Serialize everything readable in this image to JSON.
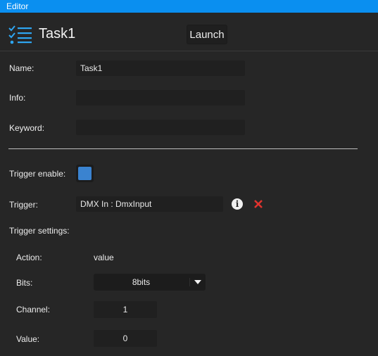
{
  "window": {
    "title": "Editor"
  },
  "header": {
    "icon": "task-list-icon",
    "title": "Task1",
    "launch_label": "Launch"
  },
  "form": {
    "name_label": "Name:",
    "name_value": "Task1",
    "info_label": "Info:",
    "info_value": "",
    "keyword_label": "Keyword:",
    "keyword_value": "",
    "trigger_enable_label": "Trigger enable:",
    "trigger_enabled": true,
    "trigger_label": "Trigger:",
    "trigger_value": "DMX In : DmxInput",
    "trigger_settings_label": "Trigger settings:"
  },
  "trigger_settings": {
    "action_label": "Action:",
    "action_value": "value",
    "bits_label": "Bits:",
    "bits_value": "8bits",
    "channel_label": "Channel:",
    "channel_value": "1",
    "value_label": "Value:",
    "value_value": "0"
  },
  "icons": {
    "info": "info-icon",
    "delete": "delete-icon"
  },
  "colors": {
    "titlebar": "#0a8ff0",
    "accent": "#3a83d0",
    "delete": "#e0332e",
    "background": "#262626"
  }
}
